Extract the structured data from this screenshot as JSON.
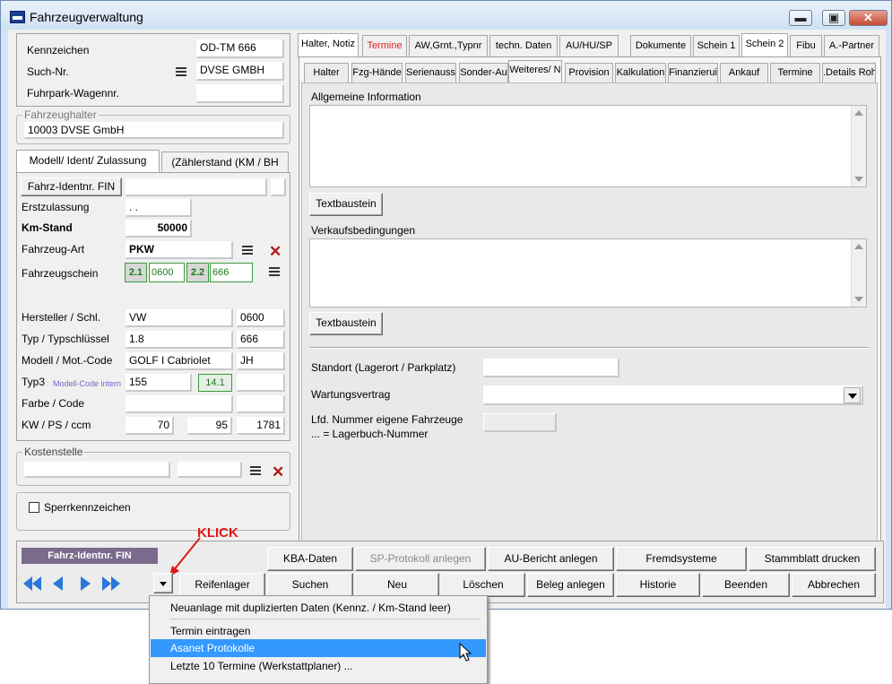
{
  "window": {
    "title": "Fahrzeugverwaltung",
    "min_glyph": "▬",
    "max_glyph": "▣",
    "close_glyph": "✕"
  },
  "vehicle": {
    "kennzeichen_label": "Kennzeichen",
    "kennzeichen": "OD-TM 666",
    "suchnr_label": "Such-Nr.",
    "suchnr": "DVSE GMBH",
    "fuhrpark_label": "Fuhrpark-Wagennr.",
    "fuhrpark": ""
  },
  "halter": {
    "group_label": "Fahrzeughalter",
    "value": "10003 DVSE GmbH"
  },
  "left_tabs": [
    "Modell/ Ident/ Zulassung",
    "(Zählerstand (KM / BH"
  ],
  "model": {
    "fin_button": "Fahrz-Identnr. FIN",
    "erstzulassung_label": "Erstzulassung",
    "erstzulassung": ". .",
    "kmstand_label": "Km-Stand",
    "kmstand": "50000",
    "fahrzeugart_label": "Fahrzeug-Art",
    "fahrzeugart": "PKW",
    "fahrzeugschein_label": "Fahrzeugschein",
    "schein_21_label": "2.1",
    "schein_21": "0600",
    "schein_22_label": "2.2",
    "schein_22": "666",
    "hersteller_label": "Hersteller / Schl.",
    "hersteller": "VW",
    "hersteller_schl": "0600",
    "typ_label": "Typ / Typschlüssel",
    "typ": "1.8",
    "typ_schl": "666",
    "modell_label": "Modell / Mot.-Code",
    "modell": "GOLF I Cabriolet",
    "motcode": "JH",
    "typ3_label": "Typ3",
    "modellcode_label": "Modell-Code intern",
    "typ3": "155",
    "typ3_green": "14.1",
    "farbe_label": "Farbe / Code",
    "kw_label": "KW / PS / ccm",
    "kw": "70",
    "ps": "95",
    "ccm": "1781"
  },
  "kostenstelle": {
    "group_label": "Kostenstelle"
  },
  "sperr": {
    "label": "Sperrkennzeichen"
  },
  "main_tabs": [
    "Halter, Notiz",
    "Termine",
    "AW,Grnt.,Typnr",
    "techn. Daten",
    "AU/HU/SP",
    "Dokumente",
    "Schein 1",
    "Schein 2",
    "Fibu",
    "A.-Partner"
  ],
  "sub_tabs": [
    "Halter",
    "Fzg-Hände",
    "Serienauss",
    "Sonder-Au",
    "Weiteres/ N",
    "Provision",
    "Kalkulation",
    "Finanzierui",
    "Ankauf",
    "Termine",
    ".Details Roh"
  ],
  "weiteres": {
    "allg_label": "Allgemeine Information",
    "textbaustein1": "Textbaustein",
    "verkauf_label": "Verkaufsbedingungen",
    "textbaustein2": "Textbaustein",
    "standort_label": "Standort (Lagerort / Parkplatz)",
    "wartung_label": "Wartungsvertrag",
    "lfd_label1": "Lfd. Nummer eigene Fahrzeuge",
    "lfd_label2": "... = Lagerbuch-Nummer"
  },
  "bottom": {
    "fin_badge": "Fahrz-Identnr. FIN",
    "klick": "KLICK",
    "row1": [
      "KBA-Daten",
      "SP-Protokoll anlegen",
      "AU-Bericht anlegen",
      "Fremdsysteme",
      "Stammblatt drucken"
    ],
    "row2": [
      "Reifenlager",
      "Suchen",
      "Neu",
      "Löschen",
      "Beleg anlegen",
      "Historie",
      "Beenden",
      "Abbrechen"
    ],
    "nav": [
      "first-icon",
      "prev-icon",
      "next-icon",
      "last-icon"
    ]
  },
  "menu": {
    "items": [
      "Neuanlage mit duplizierten Daten (Kennz. / Km-Stand leer)",
      "Termin eintragen",
      "Asanet Protokolle",
      "Letzte 10 Termine (Werkstattplaner) ..."
    ],
    "highlight_color": "#3399ff"
  }
}
